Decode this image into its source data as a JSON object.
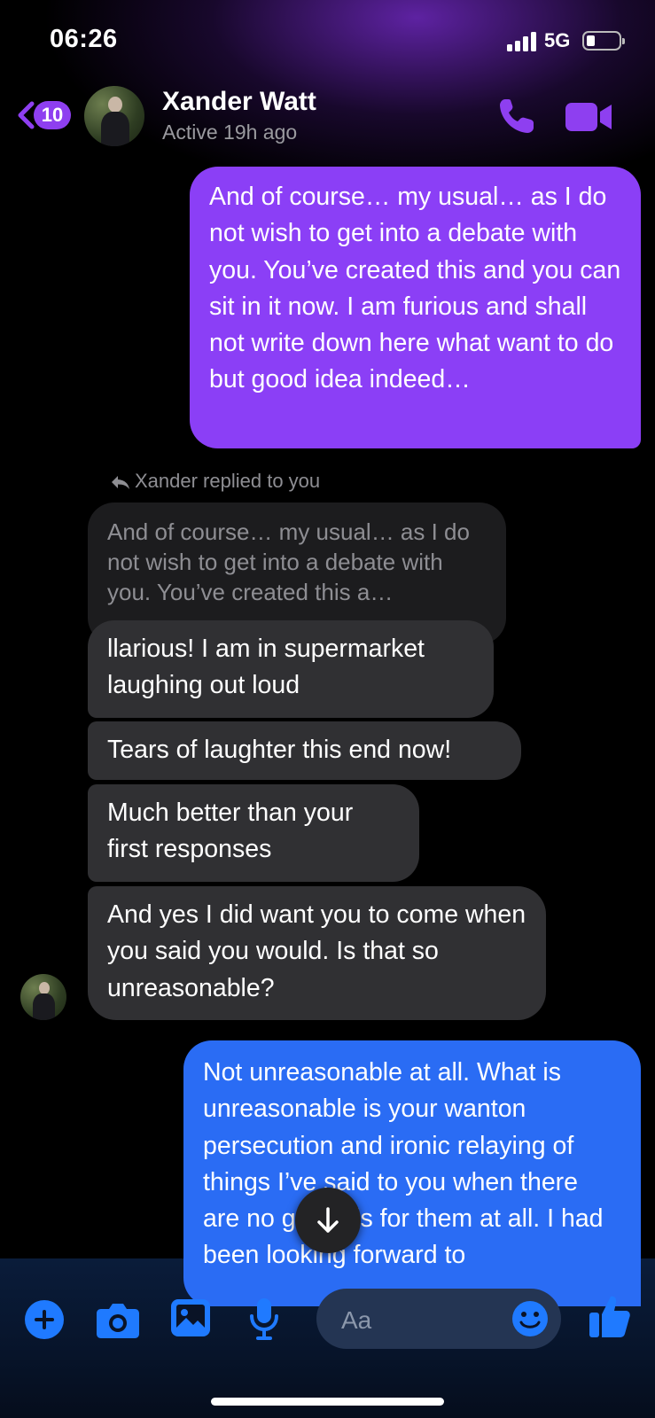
{
  "status_bar": {
    "time": "06:26",
    "network": "5G",
    "battery_fraction": 0.25
  },
  "header": {
    "back_count": "10",
    "contact_name": "Xander Watt",
    "contact_status": "Active 19h ago",
    "icons": {
      "back": "chevron-left-icon",
      "call": "phone-icon",
      "video": "video-camera-icon"
    },
    "accent_color": "#8e3ff0"
  },
  "messages": {
    "outgoing_1": "And of course… my usual… as I do not wish to get into a debate with you. You’ve created this and you can sit in it now. I am furious and shall not write down here what want to do but good idea indeed…",
    "reply_label": "Xander replied to you",
    "quoted_preview": "And of course… my usual… as I do not wish to get into a debate with you. You’ve created this a…",
    "incoming_1": "llarious! I am in supermarket laughing out loud",
    "incoming_2": "Tears of laughter this end now!",
    "incoming_3": "Much better than your first responses",
    "incoming_4": "And yes I did want you to come when you said you would. Is that so unreasonable?",
    "outgoing_2": "Not unreasonable at all. What is unreasonable is your wanton persecution and ironic relaying of things I’ve said to you when there are no grounds for them at all. I had been looking forward to"
  },
  "composer": {
    "placeholder": "Aa",
    "icons": [
      "plus-icon",
      "camera-icon",
      "image-icon",
      "microphone-icon",
      "emoji-icon",
      "thumbs-up-icon"
    ],
    "accent_color": "#1f7aff"
  },
  "colors": {
    "outgoing_purple": "#8b3ff6",
    "outgoing_blue": "#2a6cf4",
    "incoming_gray": "#303033"
  }
}
